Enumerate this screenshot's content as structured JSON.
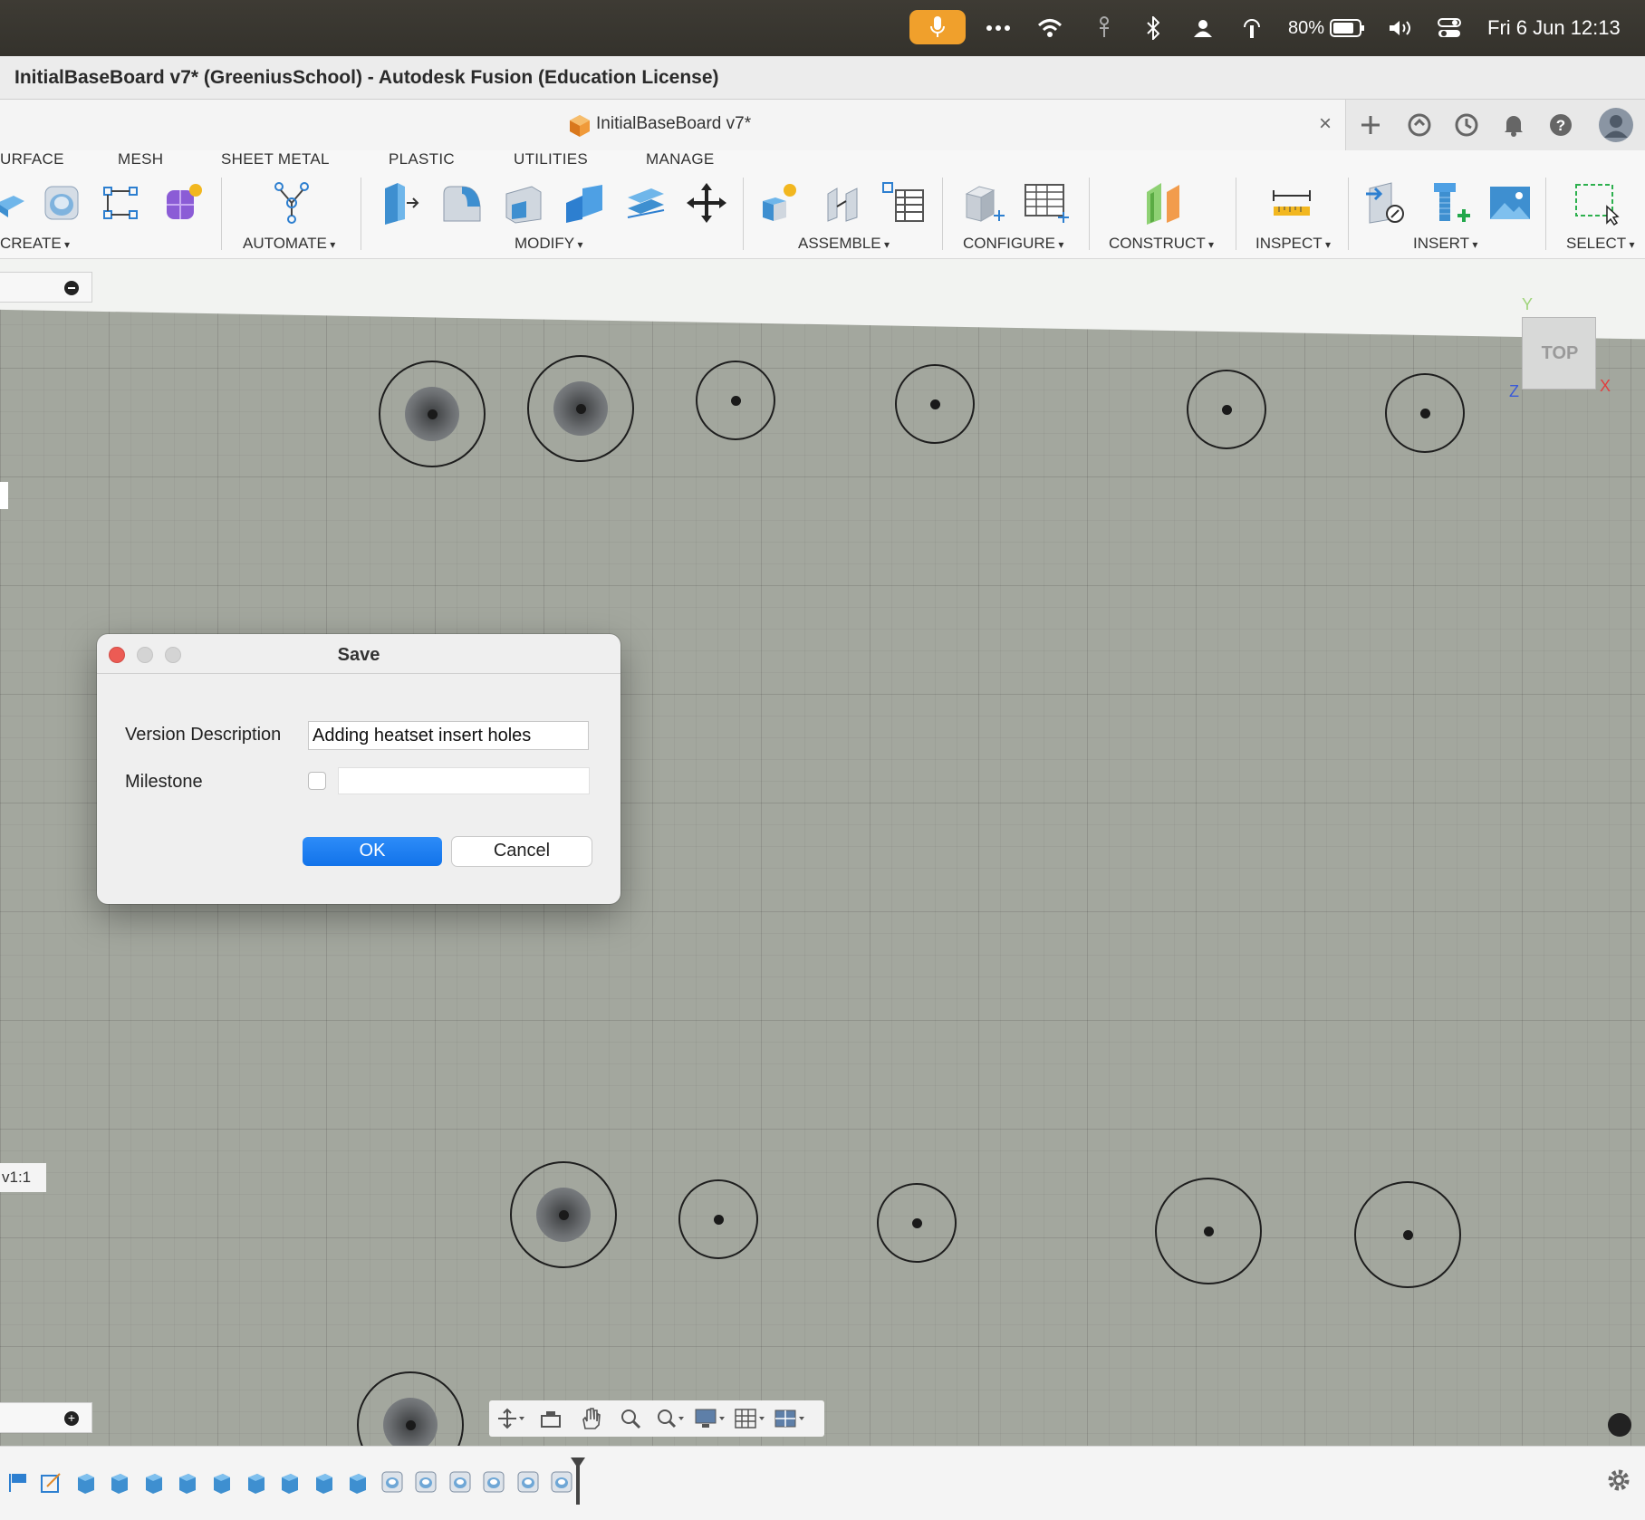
{
  "menubar": {
    "battery_percent": "80%",
    "clock": "Fri 6 Jun  12:13",
    "icons": [
      "microphone-icon",
      "more-icon",
      "wifi-icon",
      "accessibility-icon",
      "bluetooth-icon",
      "user-icon",
      "airplay-icon",
      "battery-icon",
      "volume-icon",
      "control-center-icon"
    ],
    "mic_color": "#f0a02c"
  },
  "window": {
    "title": "InitialBaseBoard v7* (GreeniusSchool) - Autodesk Fusion (Education License)"
  },
  "document_tab": {
    "label": "InitialBaseBoard v7*",
    "close": "×"
  },
  "toolbar": {
    "tabs": [
      "URFACE",
      "MESH",
      "SHEET METAL",
      "PLASTIC",
      "UTILITIES",
      "MANAGE"
    ],
    "groups": {
      "create": "CREATE",
      "automate": "AUTOMATE",
      "modify": "MODIFY",
      "assemble": "ASSEMBLE",
      "configure": "CONFIGURE",
      "construct": "CONSTRUCT",
      "inspect": "INSPECT",
      "insert": "INSERT",
      "select": "SELECT"
    }
  },
  "viewport": {
    "viewcube_face": "TOP",
    "axes": {
      "y": "Y",
      "z": "Z",
      "x": "X"
    },
    "scale_label": "v1:1",
    "hole_count": 14
  },
  "dialog": {
    "title": "Save",
    "version_label": "Version Description",
    "version_value": "Adding heatset insert holes",
    "milestone_label": "Milestone",
    "milestone_checked": false,
    "ok_label": "OK",
    "cancel_label": "Cancel",
    "accent_color": "#1a7cf0"
  }
}
